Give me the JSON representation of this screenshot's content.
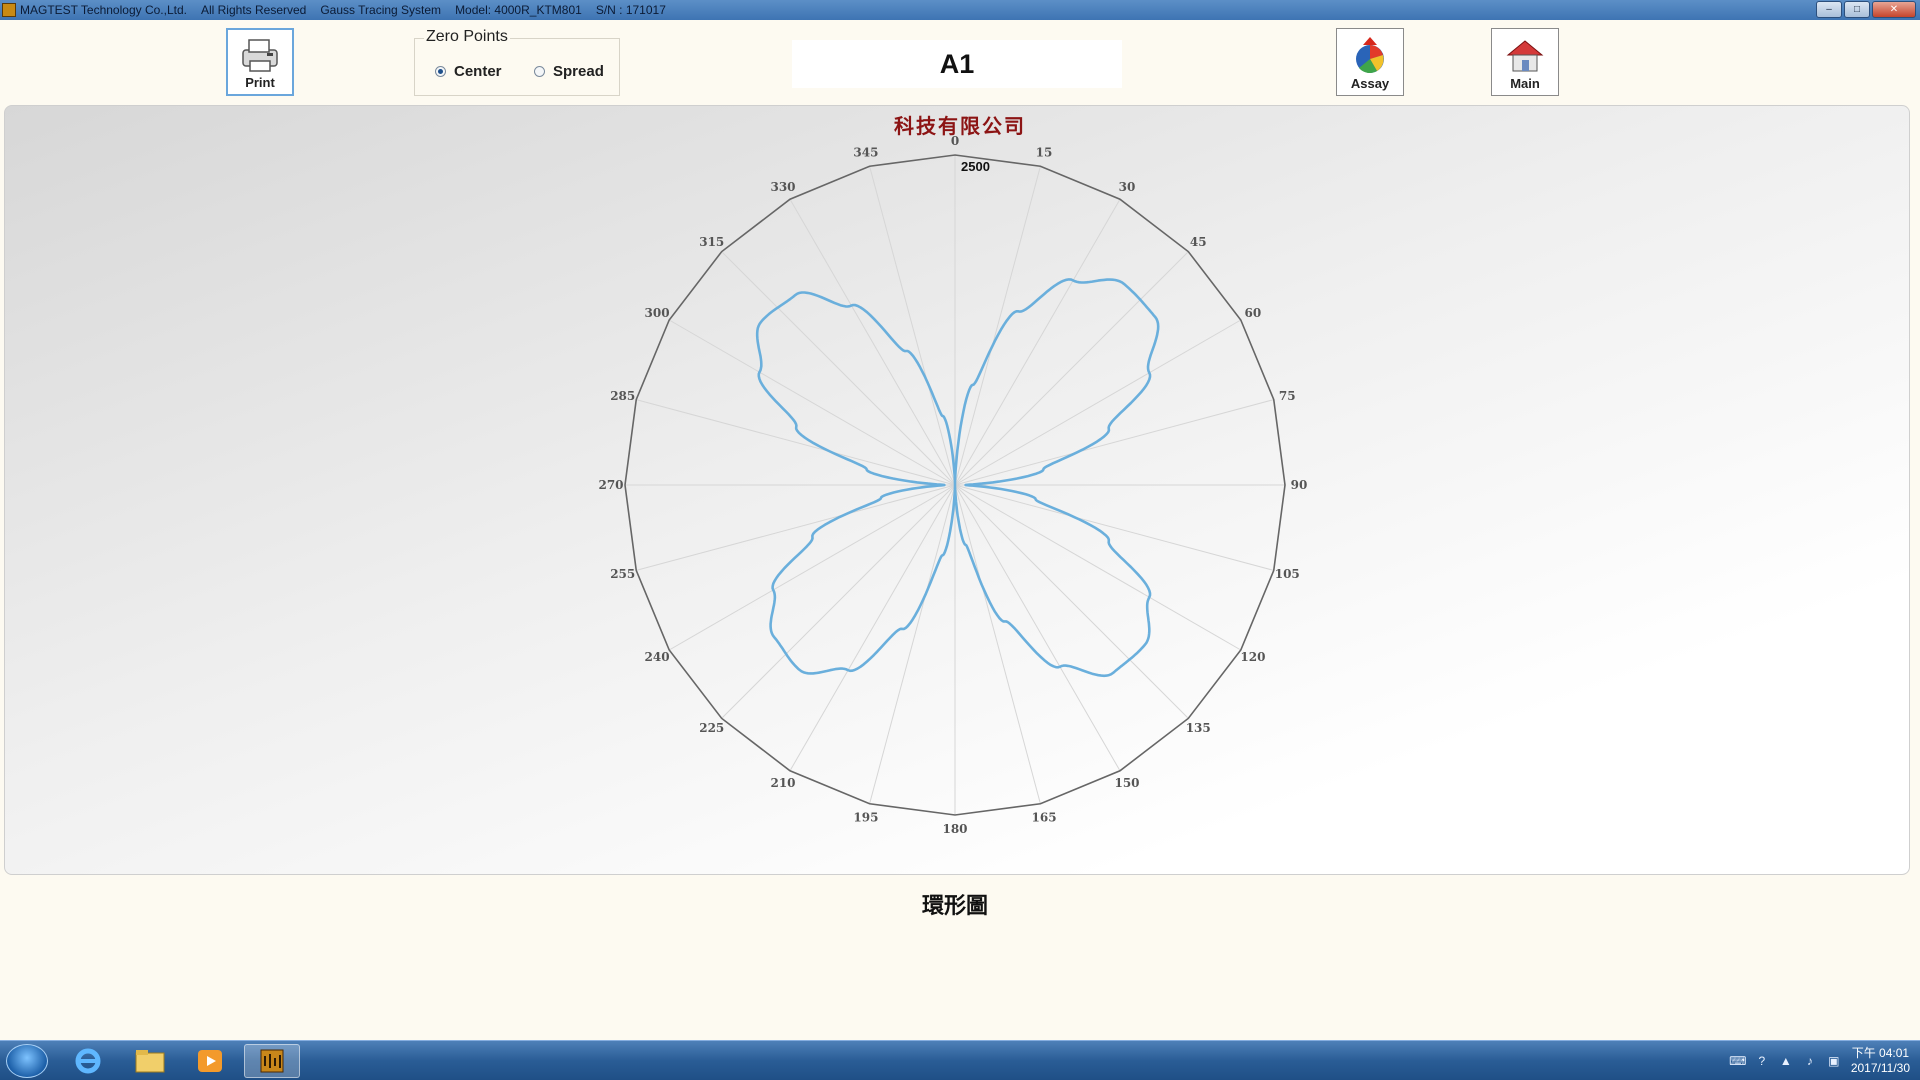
{
  "window": {
    "title_segments": [
      "MAGTEST Technology Co.,Ltd.",
      "All Rights Reserved",
      "Gauss Tracing System",
      "Model: 4000R_KTM801",
      "S/N : 171017"
    ],
    "controls": {
      "minimize": "–",
      "maximize": "□",
      "close": "✕"
    }
  },
  "toolbar": {
    "print_label": "Print",
    "assay_label": "Assay",
    "main_label": "Main"
  },
  "zero_points": {
    "title": "Zero Points",
    "options": [
      {
        "label": "Center",
        "selected": true
      },
      {
        "label": "Spread",
        "selected": false
      }
    ]
  },
  "sample_label": "A1",
  "chart_title": "科技有限公司",
  "caption": "環形圖",
  "chart_data": {
    "type": "polar-line",
    "title": "科技有限公司",
    "angular_ticks": [
      "0",
      "15",
      "30",
      "45",
      "60",
      "75",
      "90",
      "105",
      "120",
      "135",
      "150",
      "165",
      "180",
      "195",
      "210",
      "225",
      "240",
      "255",
      "270",
      "285",
      "300",
      "315",
      "330",
      "345"
    ],
    "radial_max": 2500,
    "radial_max_label": "2500",
    "series": [
      {
        "name": "",
        "color": "#6aafdc",
        "theta": [
          0,
          10,
          20,
          30,
          40,
          50,
          60,
          70,
          80,
          90,
          100,
          110,
          120,
          130,
          140,
          150,
          160,
          170,
          180,
          190,
          200,
          210,
          220,
          230,
          240,
          250,
          260,
          270,
          280,
          290,
          300,
          310,
          320,
          330,
          340,
          350,
          360
        ],
        "r": [
          0,
          770,
          1400,
          1790,
          1990,
          1980,
          1700,
          1240,
          680,
          80,
          620,
          1240,
          1700,
          1880,
          1860,
          1590,
          1100,
          460,
          0,
          540,
          1160,
          1620,
          1830,
          1790,
          1590,
          1150,
          570,
          80,
          680,
          1280,
          1710,
          1920,
          1880,
          1570,
          1080,
          530,
          0
        ]
      }
    ],
    "grid": true
  },
  "taskbar": {
    "clock_time": "下午 04:01",
    "clock_date": "2017/11/30"
  }
}
